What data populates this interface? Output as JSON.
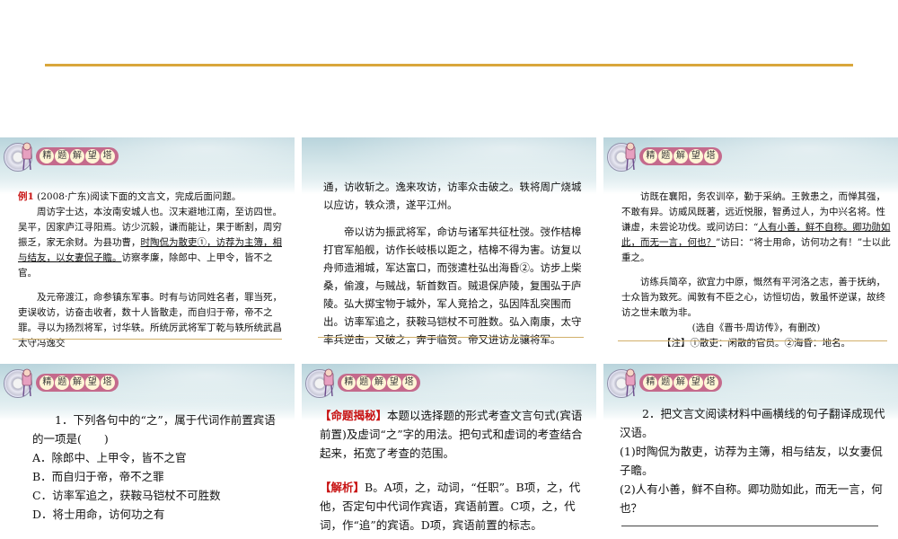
{
  "panel1": {
    "logo_chars": [
      "精",
      "题",
      "解",
      "望",
      "塔"
    ],
    "example_label": "例1",
    "lead": "(2008·广东)阅读下面的文言文，完成后面问题。",
    "para1_a": "周访字士达，本汝南安城人也。汉末避地江南，至访四世。吴平，因家庐江寻阳焉。访少沉毅，谦而能让，果于断割，周穷振乏，家无余财。为县功曹，",
    "para1_u": "时陶侃为散吏①，访荐为主簿，相与结友，以女妻侃子瞻。",
    "para1_b": "访察孝廉，除郎中、上甲令，皆不之官。",
    "para2": "及元帝渡江，命参镇东军事。时有与访同姓名者，罪当死，吏误收访，访奋击收者，数十人皆散走，而自归于帝，帝不之罪。寻以为扬烈将军，讨华轶。所统厉武将军丁乾与轶所统武昌太守冯逸交"
  },
  "panel2": {
    "logo_chars": [
      "精",
      "题",
      "解",
      "望",
      "塔"
    ],
    "para1": "通，访收斩之。逸来攻访，访率众击破之。轶将周广烧城以应访，轶众溃，遂平江州。",
    "para2": "帝以访为振武将军，命访与诸军共征杜弢。弢作桔槔打官军船舰，访作长岐棖以距之，桔槔不得为害。访复以舟师造湘城，军达富口，而弢遣杜弘出海昏②。访步上柴桑，偷渡，与贼战，斩首数百。贼退保庐陵，复围弘于庐陵。弘大掷宝物于城外，军人竞拾之，弘因阵乱突围而出。访率军追之，获鞍马铠杖不可胜数。弘入南康，太守率兵逆击，又破之，奔于临贺。帝又进访龙骧将军。"
  },
  "panel3": {
    "logo_chars": [
      "精",
      "题",
      "解",
      "望",
      "塔"
    ],
    "para1_a": "访既在襄阳，务农训卒，勤于采纳。王敦患之，而惮其强，不敢有异。访威风既著，远近悦服，智勇过人，为中兴名将。性谦虚，未尝论功伐。或问访曰：“",
    "para1_u": "人有小善，鲜不自称。卿功勋如此，而无一言，何也？",
    "para1_b": "”访曰：“将士用命，访何功之有！”士以此重之。",
    "para2": "访练兵简卒，欲宜力中原，慨然有平河洛之志，善于抚纳，士众皆为致死。闻敦有不臣之心，访恒切齿，敦虽怀逆谋，故终访之世未敢为非。",
    "source": "(选自《晋书·周访传》，有删改)",
    "note": "【注】①散吏：闲散的官员。②海昏：地名。"
  },
  "panel4": {
    "logo_chars": [
      "精",
      "题",
      "解",
      "望",
      "塔"
    ],
    "question": "1．下列各句中的“之”，属于代词作前置宾语的一项是(　　)",
    "options": [
      "A．除郎中、上甲令，皆不之官",
      "B．而自归于帝，帝不之罪",
      "C．访率军追之，获鞍马铠杖不可胜数",
      "D．将士用命，访何功之有"
    ]
  },
  "panel5": {
    "logo_chars": [
      "精",
      "题",
      "解",
      "望",
      "塔"
    ],
    "tag1": "【命题揭秘】",
    "text1": "本题以选择题的形式考查文言句式(宾语前置)及虚词“之”字的用法。把句式和虚词的考查结合起来，拓宽了考查的范围。",
    "tag2": "【解析】",
    "text2": "B。A项，之，动词，“任职”。B项，之，代他，否定句中代词作宾语，宾语前置。C项，之，代词，作“追”的宾语。D项，宾语前置的标志。"
  },
  "panel6": {
    "logo_chars": [
      "精",
      "题",
      "解",
      "望",
      "塔"
    ],
    "question": "2．把文言文阅读材料中画横线的句子翻译成现代汉语。",
    "item1": "(1)时陶侃为散吏，访荐为主簿，相与结友，以女妻侃子瞻。",
    "item2": "(2)人有小善，鲜不自称。卿功勋如此，而无一言，何也？"
  },
  "colors": {
    "gold_rule": "#d9a73b",
    "accent_red": "#c81414",
    "logo_pill": "#c46a8c"
  }
}
